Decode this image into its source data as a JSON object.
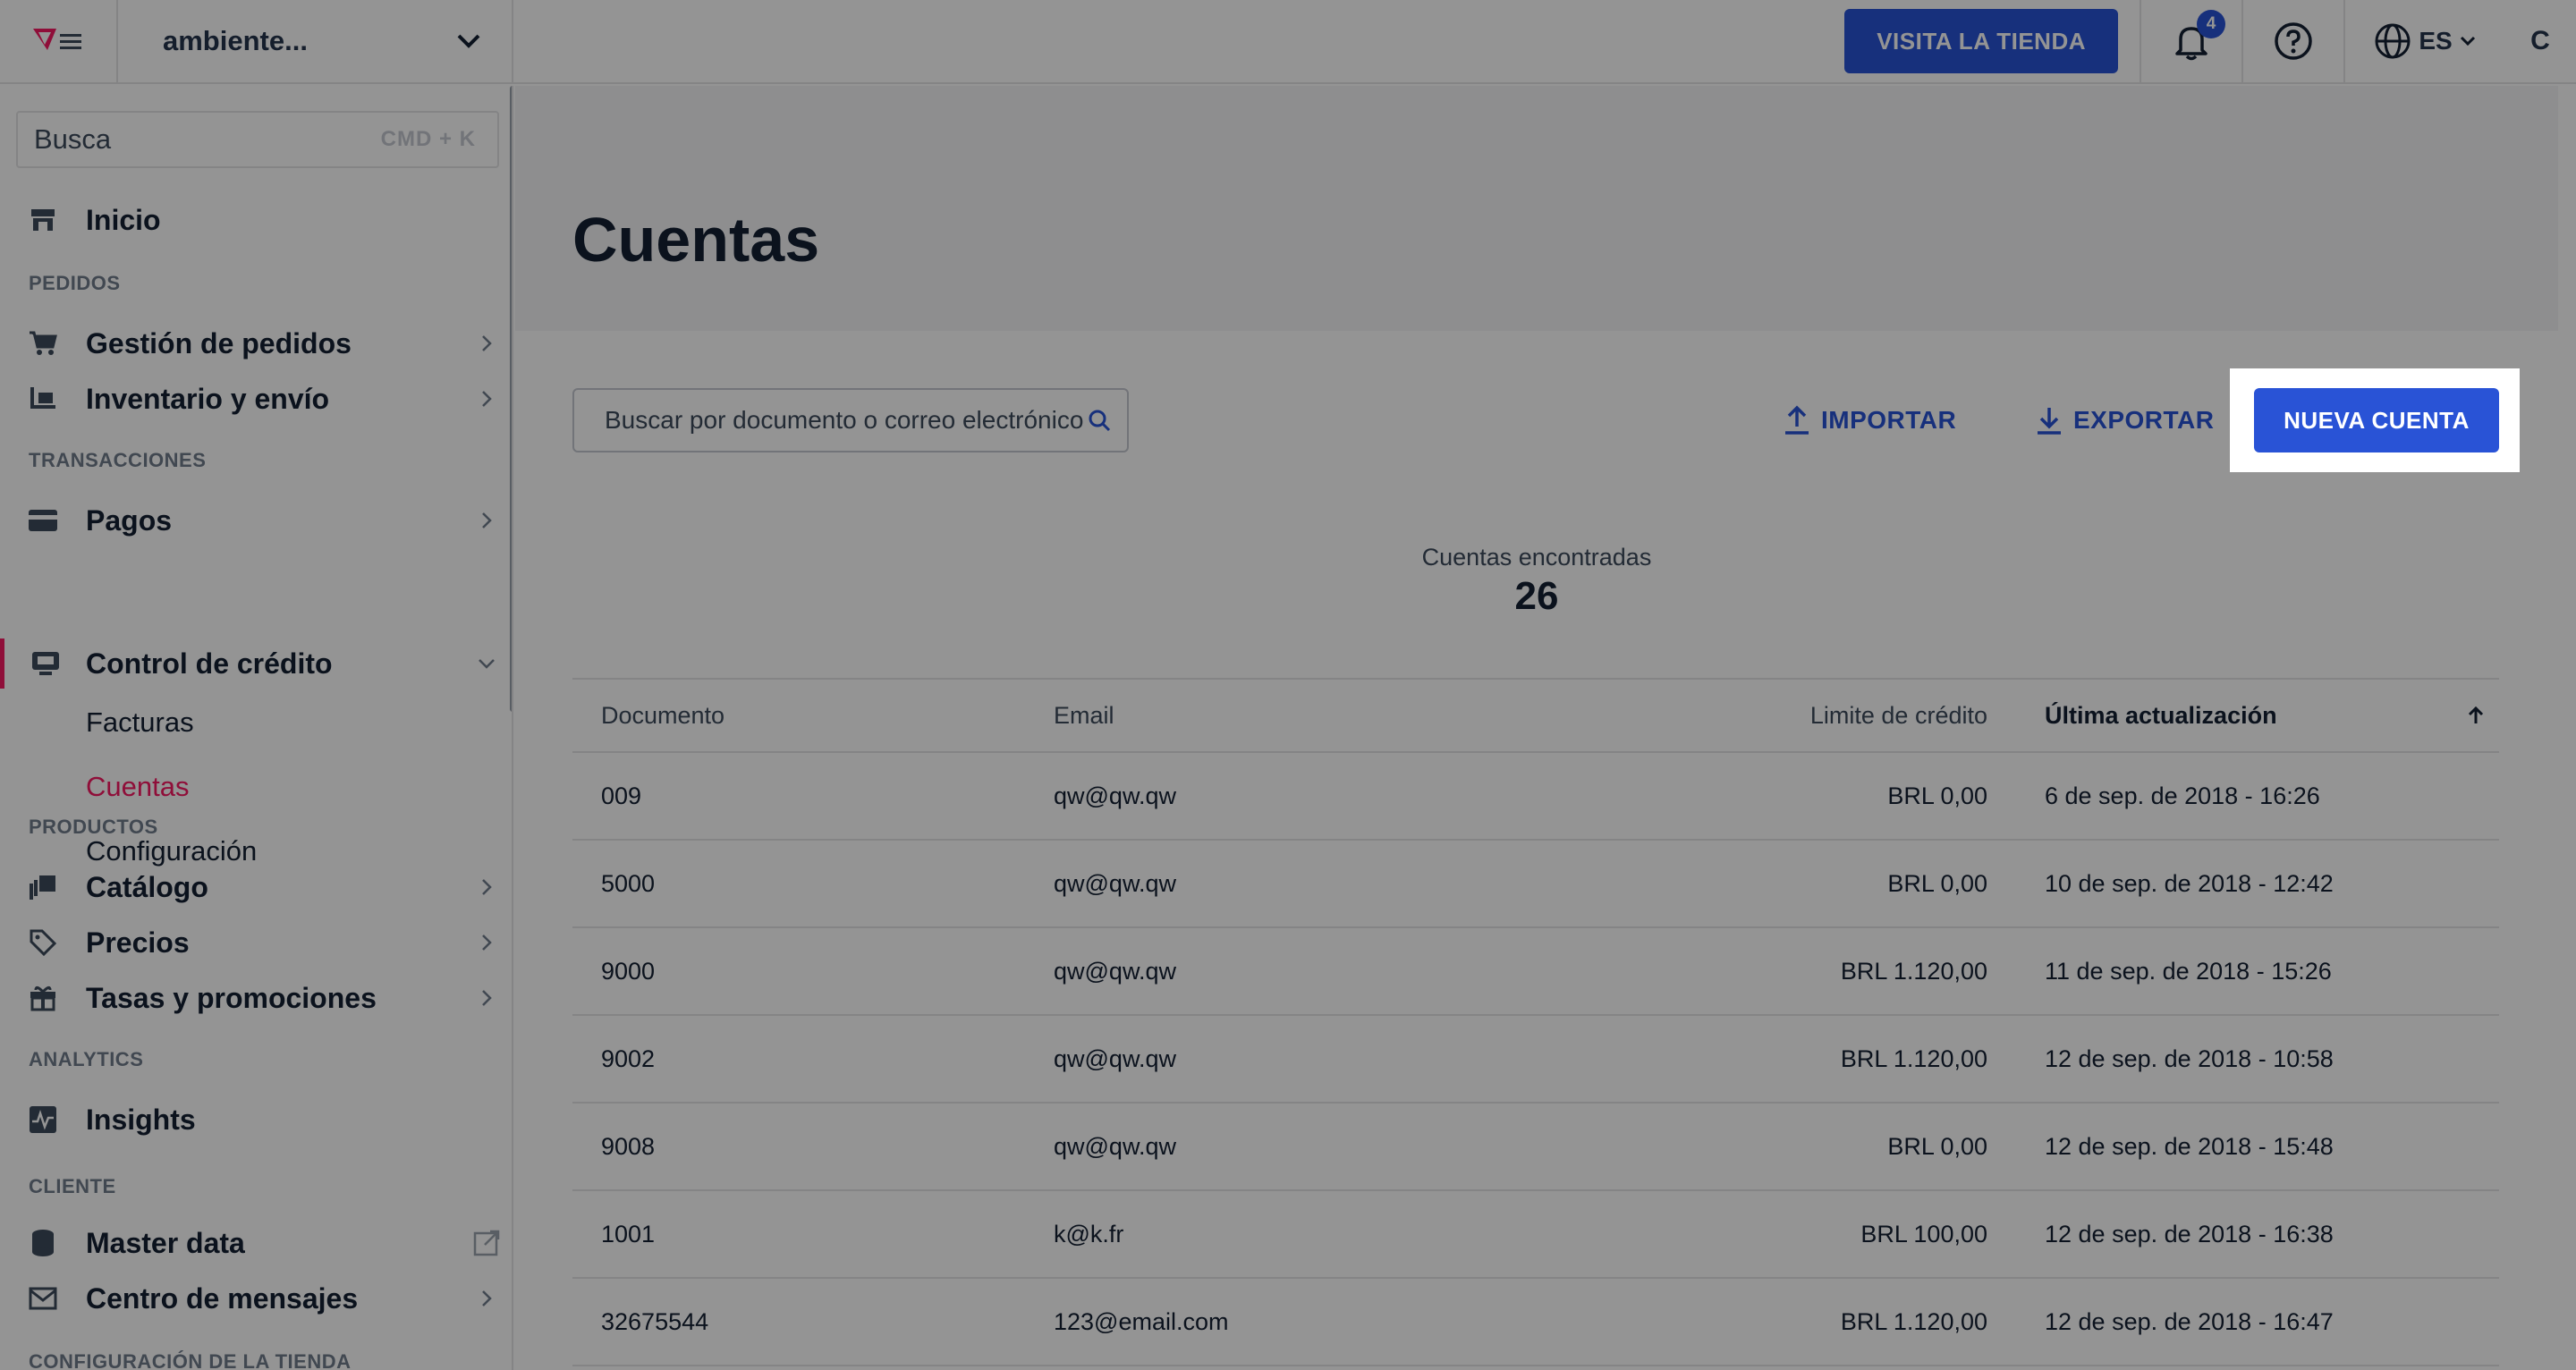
{
  "topbar": {
    "account": "ambiente...",
    "visit_store": "VISITA LA TIENDA",
    "notifications_count": "4",
    "language": "ES",
    "user_initial": "C"
  },
  "sidebar": {
    "search_placeholder": "Busca",
    "search_shortcut": "CMD + K",
    "home": "Inicio",
    "sections": {
      "orders": "PEDIDOS",
      "transactions": "TRANSACCIONES",
      "products": "PRODUCTOS",
      "analytics": "ANALYTICS",
      "customer": "CLIENTE",
      "store_settings": "CONFIGURACIÓN DE LA TIENDA"
    },
    "items": {
      "order_management": "Gestión de pedidos",
      "inventory": "Inventario y envío",
      "payments": "Pagos",
      "credit_control": "Control de crédito",
      "invoices": "Facturas",
      "accounts": "Cuentas",
      "settings": "Configuración",
      "catalog": "Catálogo",
      "prices": "Precios",
      "promotions": "Tasas y promociones",
      "insights": "Insights",
      "master_data": "Master data",
      "message_center": "Centro de mensajes"
    }
  },
  "main": {
    "title": "Cuentas",
    "search_placeholder": "Buscar por documento o correo electrónico",
    "import_label": "IMPORTAR",
    "export_label": "EXPORTAR",
    "new_account_label": "NUEVA CUENTA",
    "count_label": "Cuentas encontradas",
    "count_value": "26",
    "table": {
      "headers": {
        "document": "Documento",
        "email": "Email",
        "credit_limit": "Limite de crédito",
        "last_update": "Última actualización"
      },
      "rows": [
        {
          "document": "009",
          "email": "qw@qw.qw",
          "limit": "BRL 0,00",
          "updated": "6 de sep. de 2018 - 16:26"
        },
        {
          "document": "5000",
          "email": "qw@qw.qw",
          "limit": "BRL 0,00",
          "updated": "10 de sep. de 2018 - 12:42"
        },
        {
          "document": "9000",
          "email": "qw@qw.qw",
          "limit": "BRL 1.120,00",
          "updated": "11 de sep. de 2018 - 15:26"
        },
        {
          "document": "9002",
          "email": "qw@qw.qw",
          "limit": "BRL 1.120,00",
          "updated": "12 de sep. de 2018 - 10:58"
        },
        {
          "document": "9008",
          "email": "qw@qw.qw",
          "limit": "BRL 0,00",
          "updated": "12 de sep. de 2018 - 15:48"
        },
        {
          "document": "1001",
          "email": "k@k.fr",
          "limit": "BRL 100,00",
          "updated": "12 de sep. de 2018 - 16:38"
        },
        {
          "document": "32675544",
          "email": "123@email.com",
          "limit": "BRL 1.120,00",
          "updated": "12 de sep. de 2018 - 16:47"
        }
      ]
    }
  },
  "colors": {
    "primary": "#2953d6",
    "accent_pink": "#f71963",
    "overlay": "rgba(0,0,0,0.42)"
  }
}
